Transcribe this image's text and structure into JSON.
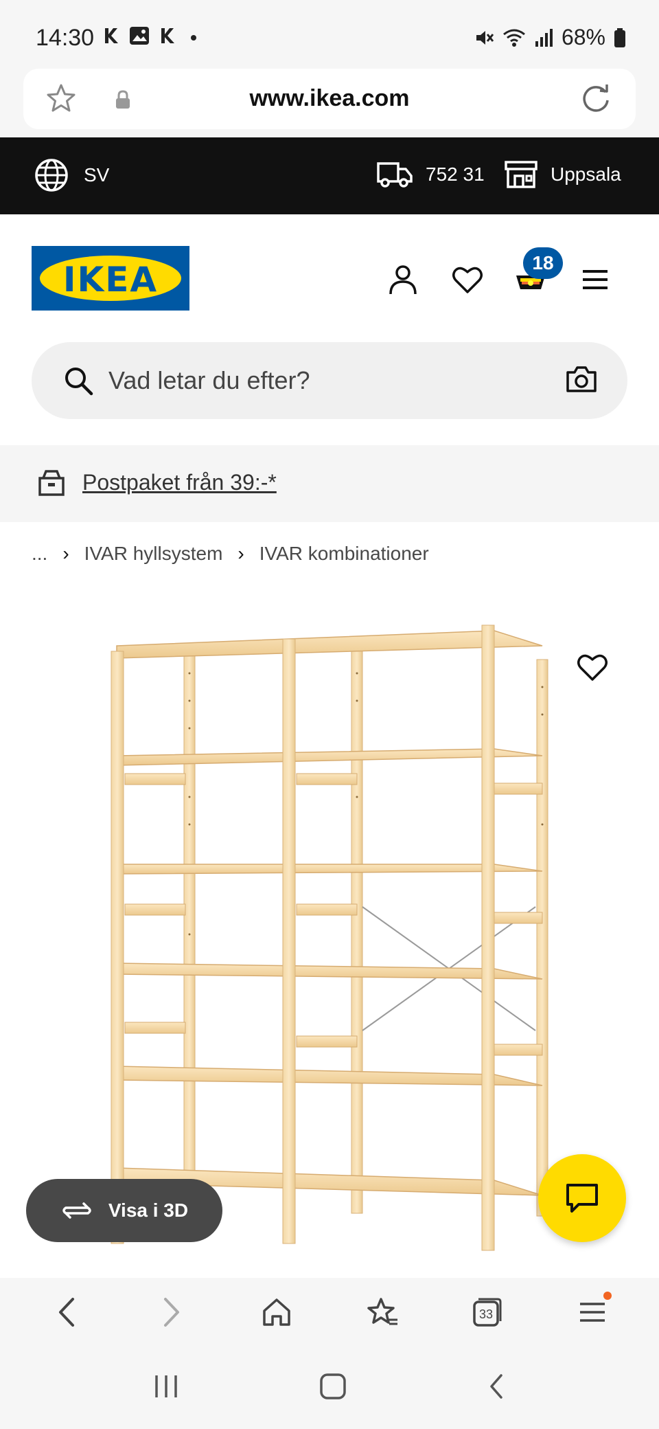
{
  "status_bar": {
    "time": "14:30",
    "battery": "68%"
  },
  "url_bar": {
    "url": "www.ikea.com"
  },
  "ribbon": {
    "language": "SV",
    "postcode": "752 31",
    "store": "Uppsala"
  },
  "header": {
    "logo_text": "IKEA",
    "cart_count": "18"
  },
  "search": {
    "placeholder": "Vad letar du efter?"
  },
  "promo": {
    "text": "Postpaket från 39:-*"
  },
  "breadcrumb": {
    "items": [
      {
        "label": "..."
      },
      {
        "label": "IVAR hyllsystem"
      },
      {
        "label": "IVAR kombinationer"
      }
    ]
  },
  "product": {
    "view_3d_label": "Visa i 3D"
  },
  "browser_nav": {
    "tabs_count": "33"
  },
  "colors": {
    "ikea_blue": "#0058a3",
    "ikea_yellow": "#ffdb00",
    "ribbon_black": "#111111"
  }
}
